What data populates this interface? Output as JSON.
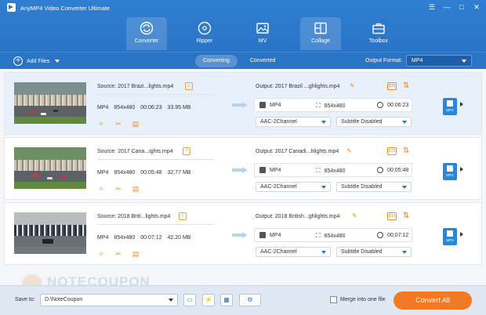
{
  "window": {
    "title": "AnyMP4 Video Converter Ultimate",
    "controls": [
      "☰",
      "—",
      "□",
      "✕"
    ]
  },
  "main_tabs": [
    {
      "label": "Converter",
      "icon": "converter-icon",
      "active": true
    },
    {
      "label": "Ripper",
      "icon": "disc-icon",
      "active": false
    },
    {
      "label": "MV",
      "icon": "image-icon",
      "active": false
    },
    {
      "label": "Collage",
      "icon": "collage-icon",
      "active": false
    },
    {
      "label": "Toolbox",
      "icon": "toolbox-icon",
      "active": false
    }
  ],
  "toolbar": {
    "add_files_label": "Add Files",
    "sub_tabs": [
      "Converting",
      "Converted"
    ],
    "output_format_label": "Output Format:",
    "output_format_value": "MP4"
  },
  "files": [
    {
      "source": "Source: 2017 Brazi...lights.mp4",
      "format": "MP4",
      "resolution": "854x480",
      "duration": "00:06:23",
      "size": "33.95 MB",
      "output": "Output: 2017 Brazil ...ghlights.mp4",
      "out_format": "MP4",
      "out_resolution": "854x480",
      "out_duration": "00:06:23",
      "audio": "AAC-2Channel",
      "subtitle": "Subtitle Disabled",
      "format_thumb_label": "MP4"
    },
    {
      "source": "Source: 2017 Cana...ights.mp4",
      "format": "MP4",
      "resolution": "854x480",
      "duration": "00:05:48",
      "size": "32.77 MB",
      "output": "Output: 2017 Canadi...hlights.mp4",
      "out_format": "MP4",
      "out_resolution": "854x480",
      "out_duration": "00:05:48",
      "audio": "AAC-2Channel",
      "subtitle": "Subtitle Disabled",
      "format_thumb_label": "MP4"
    },
    {
      "source": "Source: 2018 Briti...lights.mp4",
      "format": "MP4",
      "resolution": "854x480",
      "duration": "00:07:12",
      "size": "42.20 MB",
      "output": "Output: 2018 British...ghlights.mp4",
      "out_format": "MP4",
      "out_resolution": "854x480",
      "out_duration": "00:07:12",
      "audio": "AAC-2Channel",
      "subtitle": "Subtitle Disabled",
      "format_thumb_label": "MP4"
    }
  ],
  "labels": {
    "info": "i",
    "ids": "IDS",
    "edit_glyph": "✎",
    "merge_glyph": "⇅",
    "enhance_glyph": "✧",
    "cut_glyph": "✂",
    "edit_video_glyph": "▤",
    "res_glyph": "⛶",
    "add_glyph": "+"
  },
  "watermark_text": "NOTECOUPON",
  "bottom": {
    "save_to_label": "Save to:",
    "save_path": "D:\\NoteCoupon",
    "merge_label": "Merge into one file",
    "convert_all_label": "Convert All",
    "folder_glyph": "▭",
    "boost_glyph": "⚡",
    "hw_glyph": "▦",
    "settings_glyph": "⚙"
  },
  "colors": {
    "header": "#2a74c6",
    "accent": "#f37a22",
    "selected_row": "#e7f0fb"
  }
}
